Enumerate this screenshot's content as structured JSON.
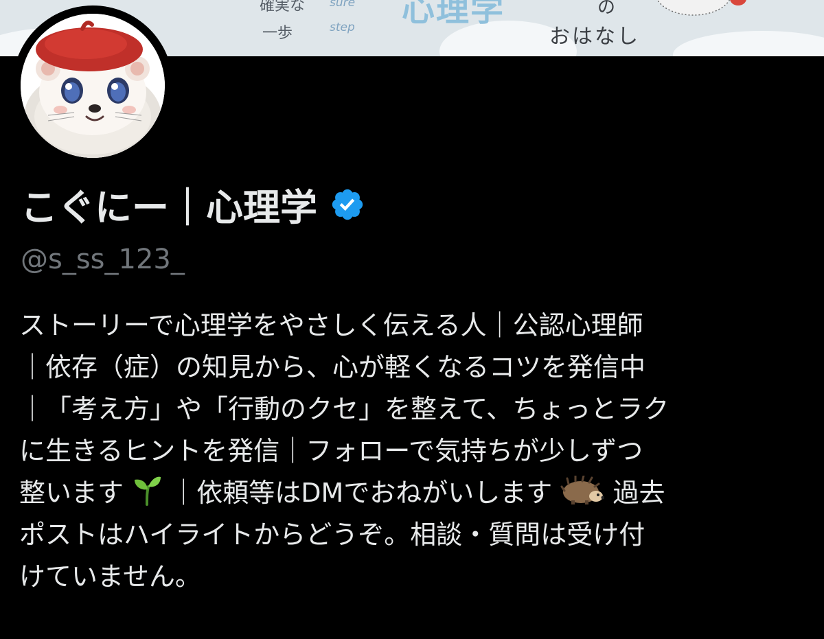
{
  "banner": {
    "tagline_jp_1": "確実な",
    "tagline_jp_2": "一歩",
    "tagline_en_1": "sure",
    "tagline_en_2": "step",
    "title": "心理学",
    "particle": "の",
    "subtitle": "おはなし"
  },
  "profile": {
    "display_name": "こぐにー｜心理学",
    "verified": true,
    "handle": "@s_ss_123_",
    "bio_lines": [
      "ストーリーで心理学をやさしく伝える人｜公認心理師",
      "｜依存（症）の知見から、心が軽くなるコツを発信中",
      "｜「考え方」や「行動のクセ」を整えて、ちょっとラク",
      "に生きるヒントを発信｜フォローで気持ちが少しずつ",
      "整います",
      "｜依頼等はDMでおねがいします",
      "過去",
      "ポストはハイライトからどうぞ。相談・質問は受け付",
      "けていません。"
    ]
  },
  "icons": {
    "verified": "verified-badge-icon",
    "seedling": "seedling-emoji",
    "hedgehog": "hedgehog-emoji"
  },
  "colors": {
    "background": "#000000",
    "text_primary": "#e7e9ea",
    "text_secondary": "#71767b",
    "verified_blue": "#1d9bf0"
  }
}
